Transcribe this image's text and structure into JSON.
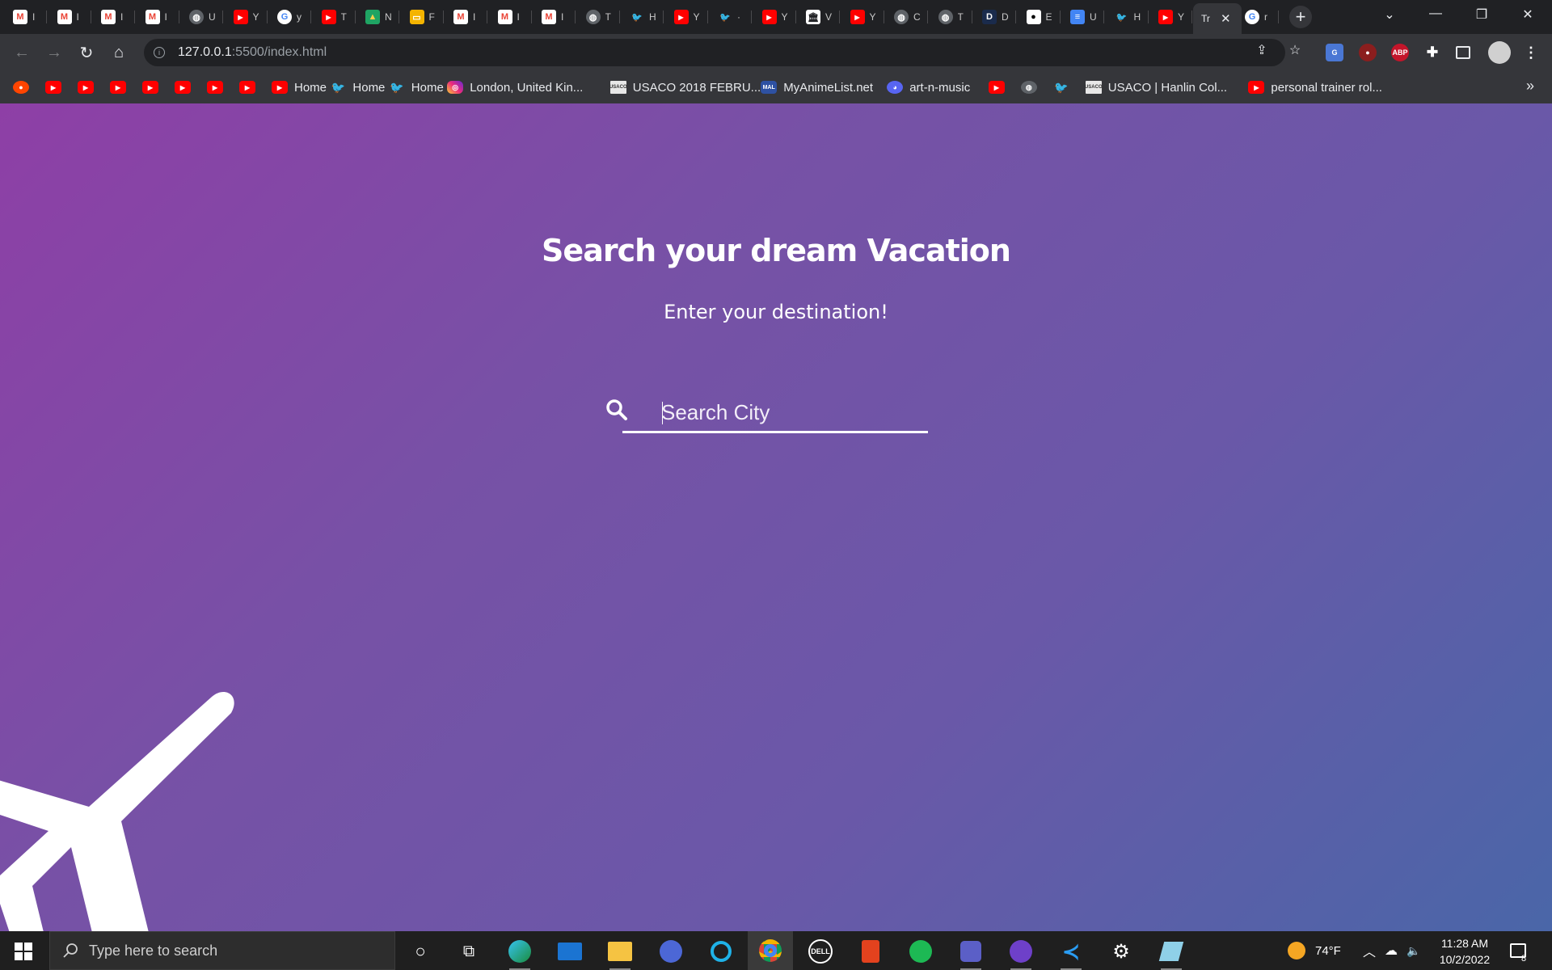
{
  "browser": {
    "tabs": [
      {
        "icon": "gmail-icon",
        "title": "I"
      },
      {
        "icon": "gmail-icon",
        "title": "I"
      },
      {
        "icon": "gmail-icon",
        "title": "I"
      },
      {
        "icon": "gmail-icon",
        "title": "I"
      },
      {
        "icon": "globe-icon",
        "title": "U"
      },
      {
        "icon": "youtube-icon",
        "title": "Y"
      },
      {
        "icon": "google-icon",
        "title": "y"
      },
      {
        "icon": "youtube-icon",
        "title": "T"
      },
      {
        "icon": "drive-icon",
        "title": "N"
      },
      {
        "icon": "slides-icon",
        "title": "F"
      },
      {
        "icon": "gmail-icon",
        "title": "I"
      },
      {
        "icon": "gmail-icon",
        "title": "I"
      },
      {
        "icon": "gmail-icon",
        "title": "I"
      },
      {
        "icon": "globe-icon",
        "title": "T"
      },
      {
        "icon": "twitter-icon",
        "title": "H"
      },
      {
        "icon": "youtube-icon",
        "title": "Y"
      },
      {
        "icon": "twitter-icon",
        "title": "·"
      },
      {
        "icon": "youtube-icon",
        "title": "Y"
      },
      {
        "icon": "museum-icon",
        "title": "V"
      },
      {
        "icon": "youtube-icon",
        "title": "Y"
      },
      {
        "icon": "globe-icon",
        "title": "C"
      },
      {
        "icon": "globe-icon",
        "title": "T"
      },
      {
        "icon": "dictionary-icon",
        "title": "D"
      },
      {
        "icon": "github-icon",
        "title": "E"
      },
      {
        "icon": "docs-icon",
        "title": "U"
      },
      {
        "icon": "twitter-icon",
        "title": "H"
      },
      {
        "icon": "youtube-icon",
        "title": "Y"
      }
    ],
    "active_tab": {
      "title": "Tr",
      "close": "✕"
    },
    "extra_tab": {
      "icon": "google-icon",
      "title": "r"
    },
    "new_tab": "+",
    "url_host": "127.0.0.1",
    "url_path": ":5500/index.html",
    "bookmarks": [
      {
        "icon": "reddit",
        "label": ""
      },
      {
        "icon": "yt",
        "label": ""
      },
      {
        "icon": "yt",
        "label": ""
      },
      {
        "icon": "yt",
        "label": ""
      },
      {
        "icon": "yt",
        "label": ""
      },
      {
        "icon": "yt",
        "label": ""
      },
      {
        "icon": "yt",
        "label": ""
      },
      {
        "icon": "yt",
        "label": ""
      },
      {
        "icon": "yt",
        "label": "Home"
      },
      {
        "icon": "tw",
        "label": "Home"
      },
      {
        "icon": "tw",
        "label": "Home"
      },
      {
        "icon": "ig",
        "label": "London, United Kin..."
      },
      {
        "icon": "usaco",
        "label": "USACO 2018 FEBRU..."
      },
      {
        "icon": "mal",
        "label": "MyAnimeList.net"
      },
      {
        "icon": "dc",
        "label": "art-n-music"
      },
      {
        "icon": "yt",
        "label": ""
      },
      {
        "icon": "globe",
        "label": ""
      },
      {
        "icon": "tw",
        "label": ""
      },
      {
        "icon": "usaco",
        "label": "USACO | Hanlin Col..."
      },
      {
        "icon": "yt",
        "label": "personal trainer rol..."
      }
    ],
    "extensions": {
      "abp": "ABP"
    },
    "more": "»"
  },
  "page": {
    "title": "Search your dream Vacation",
    "subtitle": "Enter your destination!",
    "search_placeholder": "Search City"
  },
  "taskbar": {
    "search_placeholder": "Type here to search",
    "weather": "74°F",
    "time": "11:28 AM",
    "date": "10/2/2022",
    "notifications": "8",
    "dell_label": "DELL"
  },
  "colors": {
    "gradient_start": "#8e3fa6",
    "gradient_end": "#4a66a8",
    "chrome_dark": "#202124",
    "chrome_toolbar": "#35363a"
  }
}
